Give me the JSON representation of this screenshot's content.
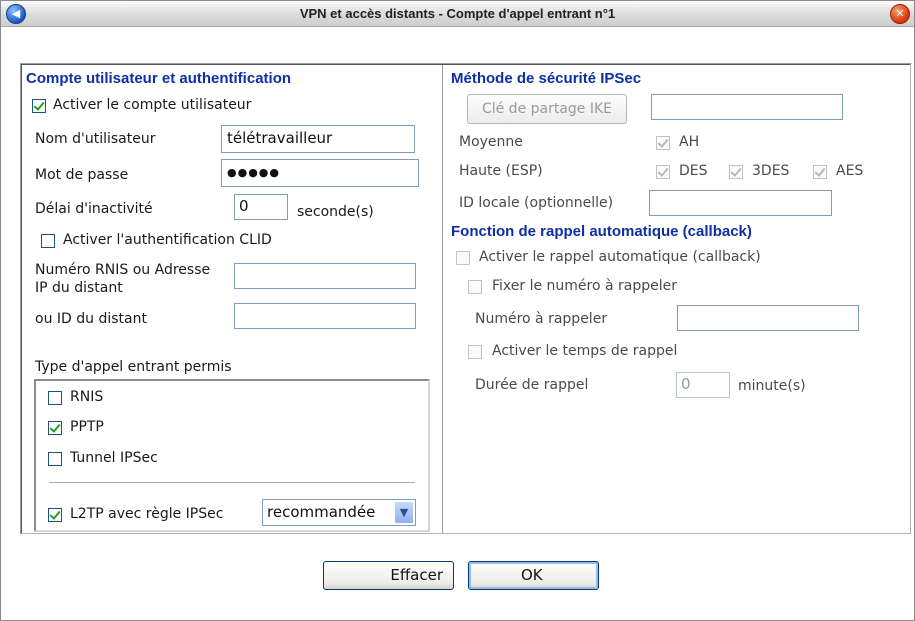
{
  "window": {
    "title": "VPN et accès distants - Compte d'appel entrant n°1"
  },
  "left": {
    "heading": "Compte utilisateur et authentification",
    "enable_account": {
      "label": "Activer le compte utilisateur",
      "checked": true
    },
    "username": {
      "label": "Nom d'utilisateur",
      "value": "télétravailleur"
    },
    "password": {
      "label": "Mot de passe",
      "value": "●●●●●"
    },
    "idle": {
      "label": "Délai d'inactivité",
      "value": "0",
      "unit": "seconde(s)"
    },
    "clid": {
      "label": "Activer l'authentification CLID",
      "checked": false
    },
    "remote_number": {
      "label": "Numéro RNIS ou Adresse IP du distant",
      "value": ""
    },
    "remote_id": {
      "label": "ou ID du distant",
      "value": ""
    },
    "call_types": {
      "title": "Type d'appel entrant permis",
      "items": [
        {
          "label": "RNIS",
          "checked": false
        },
        {
          "label": "PPTP",
          "checked": true
        },
        {
          "label": "Tunnel IPSec",
          "checked": false
        }
      ],
      "l2tp": {
        "label": "L2TP avec règle IPSec",
        "checked": true,
        "selected": "recommandée"
      }
    }
  },
  "right": {
    "ipsec_heading": "Méthode de sécurité IPSec",
    "ike_button": "Clé de partage IKE",
    "ike_value": "",
    "medium": {
      "label": "Moyenne",
      "ah": "AH"
    },
    "high": {
      "label": "Haute (ESP)",
      "des": "DES",
      "tdes": "3DES",
      "aes": "AES"
    },
    "local_id": {
      "label": "ID locale (optionnelle)",
      "value": ""
    },
    "callback_heading": "Fonction de rappel automatique (callback)",
    "callback_enable": "Activer le rappel automatique (callback)",
    "fix_number": "Fixer le numéro à rappeler",
    "number_label": "Numéro à rappeler",
    "number_value": "",
    "callback_time": "Activer le temps de rappel",
    "duration": {
      "label": "Durée de rappel",
      "value": "0",
      "unit": "minute(s)"
    }
  },
  "buttons": {
    "clear": "Effacer",
    "ok": "OK"
  }
}
